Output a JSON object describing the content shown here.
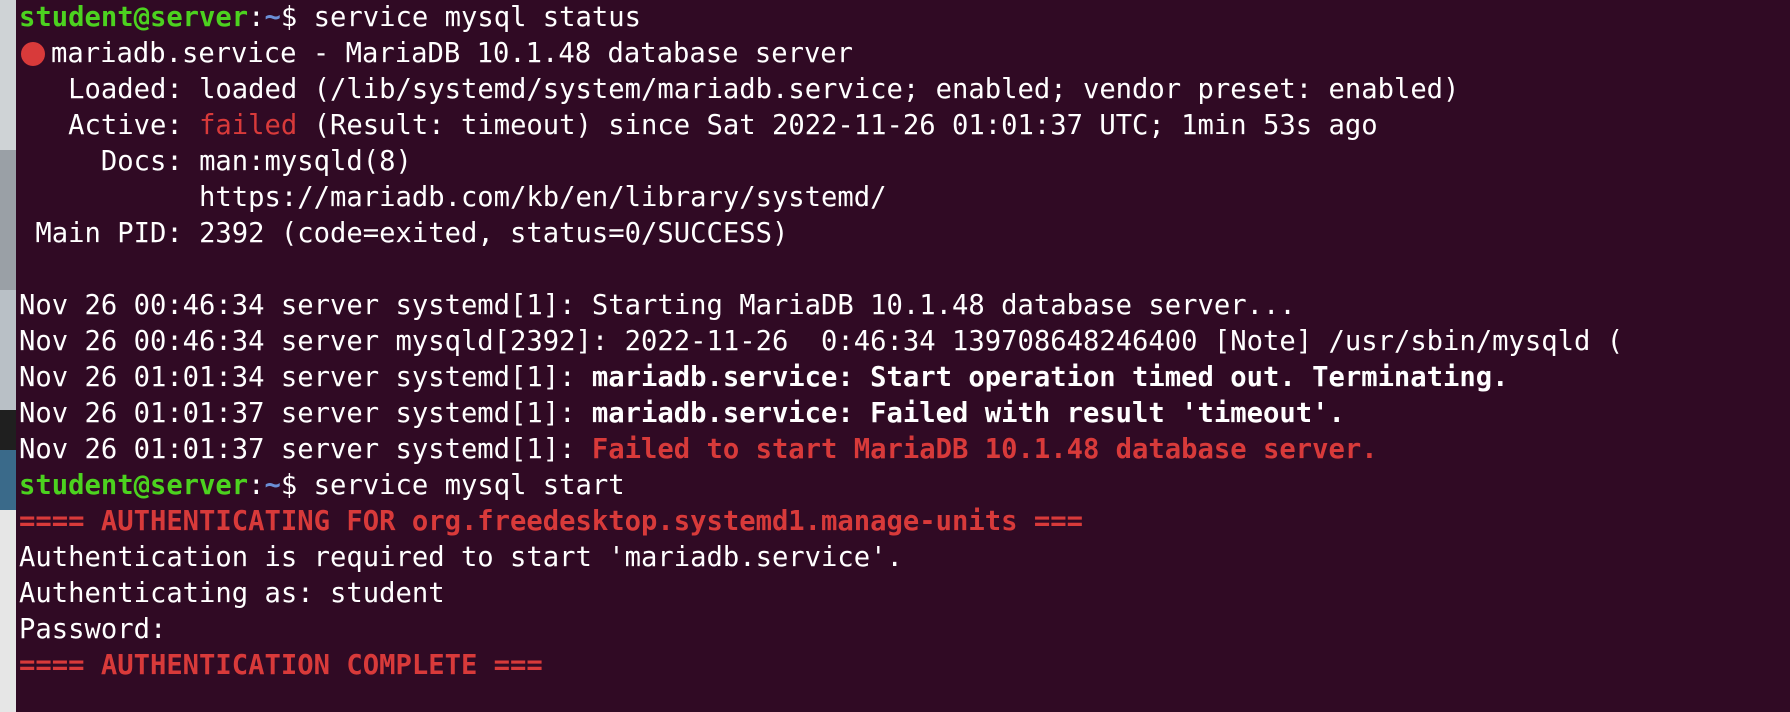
{
  "terminal": {
    "prompt": {
      "user_host": "student@server",
      "colon": ":",
      "path": "~",
      "dollar": "$ "
    },
    "cmd1": "service mysql status",
    "service_title": "mariadb.service - MariaDB 10.1.48 database server",
    "loaded": {
      "label": "   Loaded: ",
      "value": "loaded (/lib/systemd/system/mariadb.service; enabled; vendor preset: enabled)"
    },
    "active": {
      "label": "   Active: ",
      "state": "failed",
      "rest": " (Result: timeout) since Sat 2022-11-26 01:01:37 UTC; 1min 53s ago"
    },
    "docs": {
      "label": "     Docs: ",
      "value": "man:mysqld(8)"
    },
    "docs_url": "           https://mariadb.com/kb/en/library/systemd/",
    "main_pid": {
      "label": " Main PID: ",
      "value": "2392 (code=exited, status=0/SUCCESS)"
    },
    "logs": [
      {
        "prefix": "Nov 26 00:46:34 server systemd[1]: ",
        "msg": "Starting MariaDB 10.1.48 database server..."
      },
      {
        "prefix": "Nov 26 00:46:34 server mysqld[2392]: ",
        "msg": "2022-11-26  0:46:34 139708648246400 [Note] /usr/sbin/mysqld ("
      },
      {
        "prefix": "Nov 26 01:01:34 server systemd[1]: ",
        "msg": "mariadb.service: Start operation timed out. Terminating."
      },
      {
        "prefix": "Nov 26 01:01:37 server systemd[1]: ",
        "msg": "mariadb.service: Failed with result 'timeout'."
      },
      {
        "prefix": "Nov 26 01:01:37 server systemd[1]: ",
        "msg": "Failed to start MariaDB 10.1.48 database server."
      }
    ],
    "cmd2": "service mysql start",
    "auth_header": "==== AUTHENTICATING FOR org.freedesktop.systemd1.manage-units ===",
    "auth_required": "Authentication is required to start 'mariadb.service'.",
    "auth_as": "Authenticating as: student",
    "password": "Password: ",
    "auth_complete": "==== AUTHENTICATION COMPLETE ==="
  },
  "colors": {
    "background": "#300a24",
    "prompt_user": "#4cd21f",
    "prompt_path": "#6b8fd6",
    "error": "#d83a3a"
  }
}
